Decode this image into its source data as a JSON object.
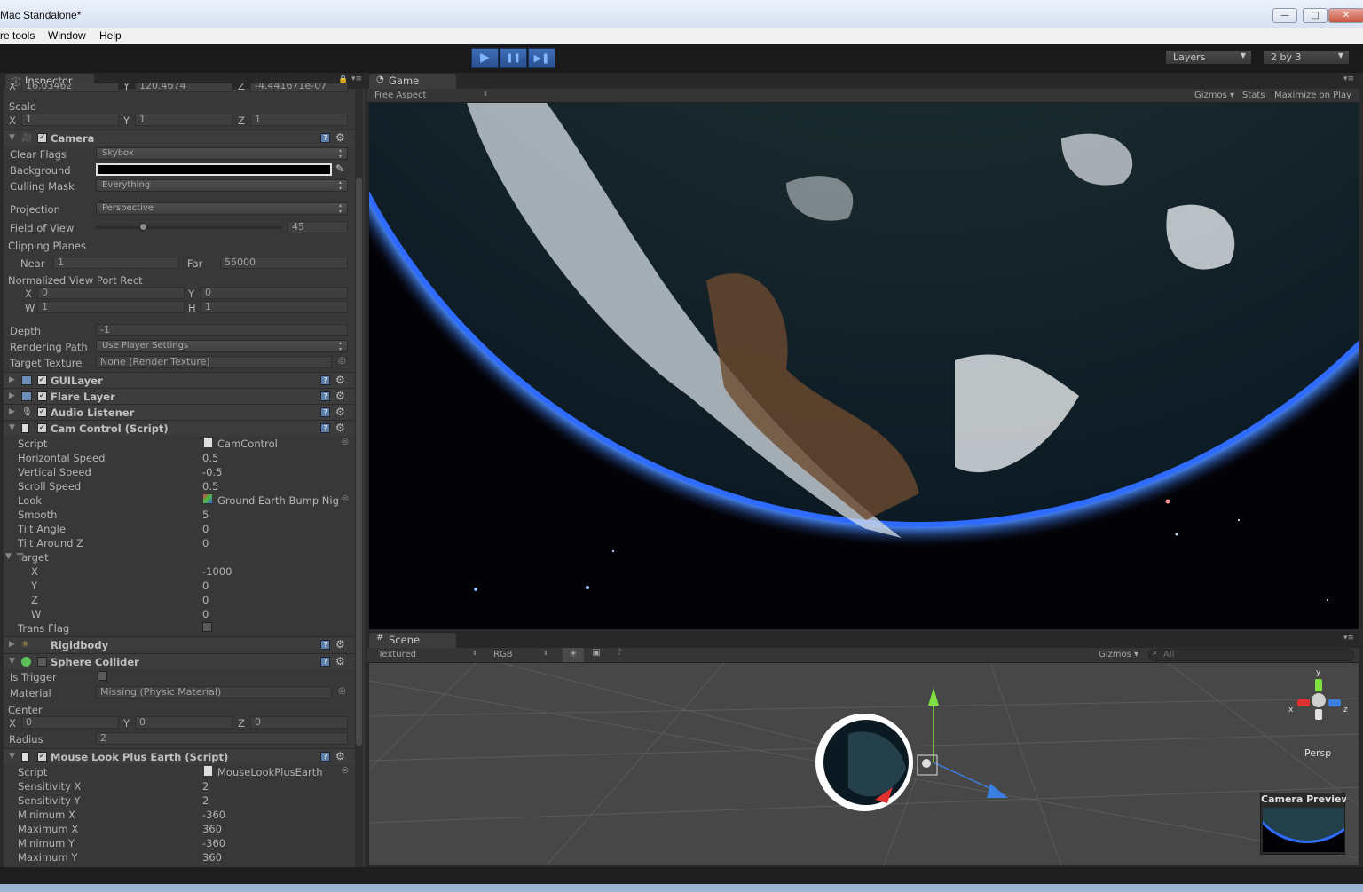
{
  "window": {
    "title": "Mac Standalone*",
    "controls": {
      "minimize": "—",
      "maximize": "□",
      "close": "✕"
    }
  },
  "menu": {
    "items": [
      "re tools",
      "Window",
      "Help"
    ]
  },
  "toolbar": {
    "play": "▶",
    "pause": "❚❚",
    "step": "▶❚",
    "layers": "Layers",
    "layout": "2 by 3"
  },
  "inspector": {
    "tab": "Inspector",
    "transform": {
      "pos": {
        "x_label": "X",
        "x": "16.03462",
        "y_label": "Y",
        "y": "120.4674",
        "z_label": "Z",
        "z": "-4.441671e-07"
      },
      "scale_label": "Scale",
      "scale": {
        "x_label": "X",
        "x": "1",
        "y_label": "Y",
        "y": "1",
        "z_label": "Z",
        "z": "1"
      }
    },
    "camera": {
      "name": "Camera",
      "clear_flags_label": "Clear Flags",
      "clear_flags": "Skybox",
      "background_label": "Background",
      "culling_mask_label": "Culling Mask",
      "culling_mask": "Everything",
      "projection_label": "Projection",
      "projection": "Perspective",
      "fov_label": "Field of View",
      "fov": "45",
      "clipping_label": "Clipping Planes",
      "near_label": "Near",
      "near": "1",
      "far_label": "Far",
      "far": "55000",
      "viewport_label": "Normalized View Port Rect",
      "vp_x_label": "X",
      "vp_x": "0",
      "vp_y_label": "Y",
      "vp_y": "0",
      "vp_w_label": "W",
      "vp_w": "1",
      "vp_h_label": "H",
      "vp_h": "1",
      "depth_label": "Depth",
      "depth": "-1",
      "render_path_label": "Rendering Path",
      "render_path": "Use Player Settings",
      "target_tex_label": "Target Texture",
      "target_tex": "None (Render Texture)"
    },
    "components": {
      "gui": "GUILayer",
      "flare": "Flare Layer",
      "audio": "Audio Listener"
    },
    "cam_control": {
      "name": "Cam Control (Script)",
      "script_label": "Script",
      "script": "CamControl",
      "hspeed_label": "Horizontal Speed",
      "hspeed": "0.5",
      "vspeed_label": "Vertical Speed",
      "vspeed": "-0.5",
      "scroll_label": "Scroll Speed",
      "scroll": "0.5",
      "look_label": "Look",
      "look": "Ground Earth Bump Nig",
      "smooth_label": "Smooth",
      "smooth": "5",
      "tilt_label": "Tilt Angle",
      "tilt": "0",
      "tiltz_label": "Tilt Around Z",
      "tiltz": "0",
      "target_label": "Target",
      "tx_label": "X",
      "tx": "-1000",
      "ty_label": "Y",
      "ty": "0",
      "tz_label": "Z",
      "tz": "0",
      "tw_label": "W",
      "tw": "0",
      "trans_label": "Trans Flag"
    },
    "rigidbody": {
      "name": "Rigidbody"
    },
    "sphere": {
      "name": "Sphere Collider",
      "trigger_label": "Is Trigger",
      "material_label": "Material",
      "material": "Missing (Physic Material)",
      "center_label": "Center",
      "cx_label": "X",
      "cx": "0",
      "cy_label": "Y",
      "cy": "0",
      "cz_label": "Z",
      "cz": "0",
      "radius_label": "Radius",
      "radius": "2"
    },
    "mouselook": {
      "name": "Mouse Look Plus Earth (Script)",
      "script_label": "Script",
      "script": "MouseLookPlusEarth",
      "sx_label": "Sensitivity X",
      "sx": "2",
      "sy_label": "Sensitivity Y",
      "sy": "2",
      "minx_label": "Minimum X",
      "minx": "-360",
      "maxx_label": "Maximum X",
      "maxx": "360",
      "miny_label": "Minimum Y",
      "miny": "-360",
      "maxy_label": "Maximum Y",
      "maxy": "360"
    }
  },
  "game": {
    "tab": "Game",
    "aspect": "Free Aspect",
    "gizmos": "Gizmos",
    "stats": "Stats",
    "maximize": "Maximize on Play"
  },
  "scene": {
    "tab": "Scene",
    "render_mode": "Textured",
    "color_mode": "RGB",
    "gizmos": "Gizmos",
    "search_placeholder": "All",
    "persp": "Persp",
    "axis_y": "y",
    "axis_x": "x",
    "axis_z": "z",
    "camera_preview": "Camera Preview"
  },
  "colors": {
    "accent": "#3f6fb8",
    "panel": "#383838",
    "ok_green": "#60c040"
  }
}
